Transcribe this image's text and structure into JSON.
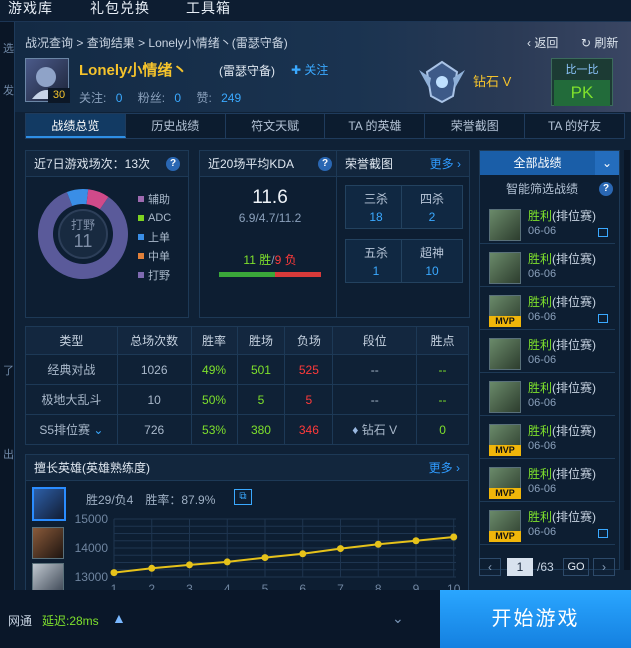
{
  "topnav": {
    "items": [
      "游戏库",
      "礼包兑换",
      "工具箱"
    ]
  },
  "left_strip": [
    "选",
    "发",
    "了",
    "出"
  ],
  "header": {
    "breadcrumb": [
      "战况查询",
      "查询结果",
      "Lonely小情绪丶(雷瑟守备)"
    ],
    "back": "返回",
    "refresh": "刷新",
    "username": "Lonely小情绪丶",
    "server": "(雷瑟守备)",
    "follow": "关注",
    "level": "30",
    "followers_label": "关注:",
    "followers": "0",
    "fans_label": "粉丝:",
    "fans": "0",
    "likes_label": "赞:",
    "likes": "249",
    "rank": "钻石 V",
    "compare_label": "比一比",
    "compare_btn": "PK"
  },
  "tabs": [
    "战绩总览",
    "历史战绩",
    "符文天赋",
    "TA 的英雄",
    "荣誉截图",
    "TA 的好友"
  ],
  "games7": {
    "title": "近7日游戏场次：13次",
    "center_label": "打野",
    "center_value": "11",
    "legend": [
      {
        "label": "辅助",
        "color": "#9e6ab0"
      },
      {
        "label": "ADC",
        "color": "#7ed321"
      },
      {
        "label": "上单",
        "color": "#3a8ee6"
      },
      {
        "label": "中单",
        "color": "#e0803a"
      },
      {
        "label": "打野",
        "color": "#7e6ab0"
      }
    ],
    "slices": [
      {
        "value": 11,
        "color": "#5a5a9a"
      },
      {
        "value": 1,
        "color": "#3a8ee6"
      },
      {
        "value": 1,
        "color": "#d04a8a"
      }
    ]
  },
  "kda": {
    "title": "近20场平均KDA",
    "value": "11.6",
    "detail": "6.9/4.7/11.2",
    "wins": "11 胜",
    "sep": "/",
    "losses": "9 负",
    "win_ratio": 0.55
  },
  "honor": {
    "title": "荣誉截图",
    "more": "更多",
    "items": [
      {
        "t": "三杀",
        "n": "18"
      },
      {
        "t": "四杀",
        "n": "2"
      },
      {
        "t": "五杀",
        "n": "1"
      },
      {
        "t": "超神",
        "n": "10"
      }
    ]
  },
  "stats": {
    "headers": [
      "类型",
      "总场次数",
      "胜率",
      "胜场",
      "负场",
      "段位",
      "胜点"
    ],
    "rows": [
      [
        "经典对战",
        "1026",
        "49%",
        "501",
        "525",
        "--",
        "--"
      ],
      [
        "极地大乱斗",
        "10",
        "50%",
        "5",
        "5",
        "--",
        "--"
      ],
      [
        "S5排位赛",
        "726",
        "53%",
        "380",
        "346",
        "钻石 V",
        "0"
      ]
    ]
  },
  "heroes": {
    "title": "擅长英雄(英雄熟练度)",
    "more": "更多",
    "record": "胜29/负4",
    "rate_label": "胜率：",
    "rate": "87.9%"
  },
  "chart_data": {
    "type": "line",
    "x": [
      1,
      2,
      3,
      4,
      5,
      6,
      7,
      8,
      9,
      10
    ],
    "values": [
      13150,
      13300,
      13420,
      13520,
      13670,
      13800,
      13980,
      14130,
      14250,
      14380
    ],
    "ylim": [
      13000,
      15000
    ],
    "yticks": [
      15000,
      14000,
      13000
    ],
    "xlabel": "",
    "ylabel": "",
    "title": "",
    "grid": true,
    "color": "#e6c21a"
  },
  "matches": {
    "filter": "全部战绩",
    "smart": "智能筛选战绩",
    "rows": [
      {
        "result": "胜利",
        "mode": "(排位赛)",
        "date": "06-06",
        "mvp": false,
        "pic": true
      },
      {
        "result": "胜利",
        "mode": "(排位赛)",
        "date": "06-06",
        "mvp": false,
        "pic": false
      },
      {
        "result": "胜利",
        "mode": "(排位赛)",
        "date": "06-06",
        "mvp": true,
        "pic": true
      },
      {
        "result": "胜利",
        "mode": "(排位赛)",
        "date": "06-06",
        "mvp": false,
        "pic": false
      },
      {
        "result": "胜利",
        "mode": "(排位赛)",
        "date": "06-06",
        "mvp": false,
        "pic": false
      },
      {
        "result": "胜利",
        "mode": "(排位赛)",
        "date": "06-06",
        "mvp": true,
        "pic": false
      },
      {
        "result": "胜利",
        "mode": "(排位赛)",
        "date": "06-06",
        "mvp": true,
        "pic": false
      },
      {
        "result": "胜利",
        "mode": "(排位赛)",
        "date": "06-06",
        "mvp": true,
        "pic": true
      }
    ],
    "page": "1",
    "total": "/63",
    "go": "GO"
  },
  "bottom": {
    "net": "网通",
    "latency": "延迟:28ms",
    "start": "开始游戏"
  },
  "colors": {
    "win": "#7ee02c",
    "loss": "#ff3a3a",
    "accent": "#2a9bff"
  }
}
